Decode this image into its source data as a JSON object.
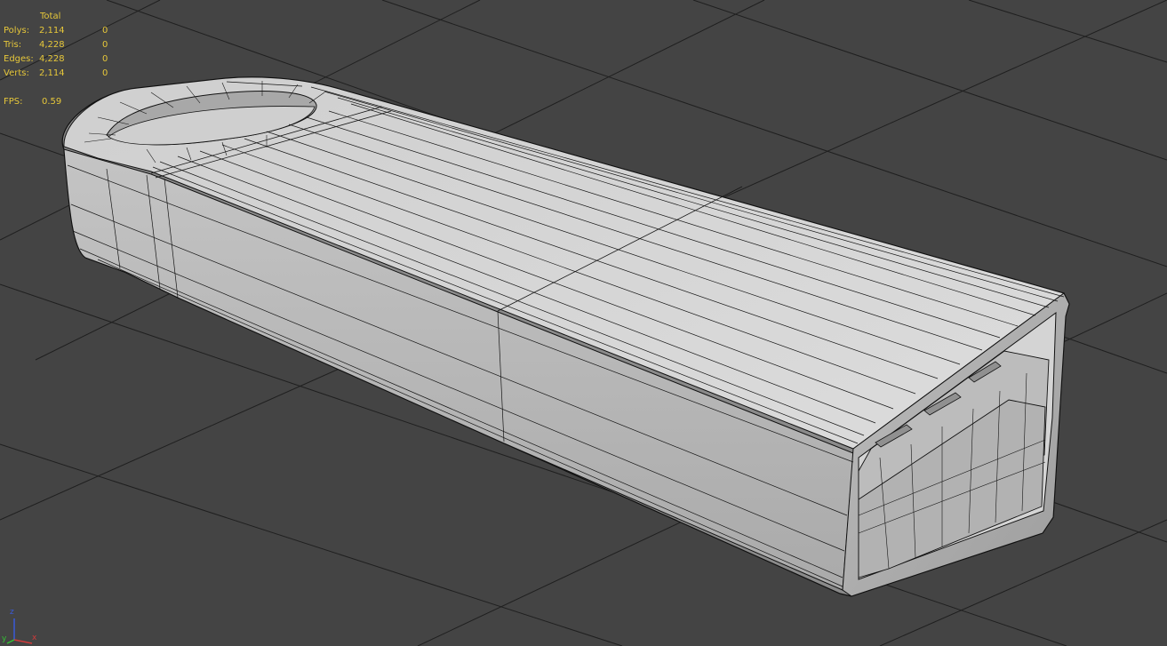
{
  "statistics": {
    "header_total": "Total",
    "rows": [
      {
        "label": "Polys:",
        "total": "2,114",
        "selected": "0"
      },
      {
        "label": "Tris:",
        "total": "4,228",
        "selected": "0"
      },
      {
        "label": "Edges:",
        "total": "4,228",
        "selected": "0"
      },
      {
        "label": "Verts:",
        "total": "2,114",
        "selected": "0"
      }
    ],
    "fps_label": "FPS:",
    "fps_value": "0.59"
  },
  "axis_gizmo": {
    "z_label": "z",
    "y_label": "y",
    "x_label": "x",
    "colors": {
      "z": "#3a5ad8",
      "y": "#34c034",
      "x": "#d03a3a"
    }
  },
  "viewport": {
    "background": "#444444",
    "grid_color": "#1e1e1e",
    "model_fill": "#c8c8c8",
    "wire_color": "#141414",
    "stats_color": "#e6c73a"
  }
}
